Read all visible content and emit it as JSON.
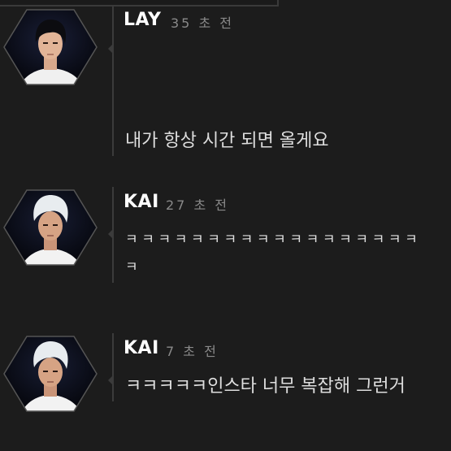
{
  "colors": {
    "background": "#1c1c1c",
    "name_text": "#ffffff",
    "time_text": "#8a8a8a",
    "message_text": "#dedede",
    "divider": "#3b3b3b"
  },
  "messages": [
    {
      "name": "LAY",
      "time": "35 초 전",
      "text": "내가 항상 시간 되면 올게요"
    },
    {
      "name": "KAI",
      "time": "27 초 전",
      "text_line1": "ㅋㅋㅋㅋㅋㅋㅋㅋㅋㅋㅋㅋㅋㅋㅋㅋㅋㅋ",
      "text_line2": "ㅋ"
    },
    {
      "name": "KAI",
      "time": "7 초 전",
      "text": "ㅋㅋㅋㅋㅋ인스타 너무 복잡해 그런거"
    }
  ]
}
